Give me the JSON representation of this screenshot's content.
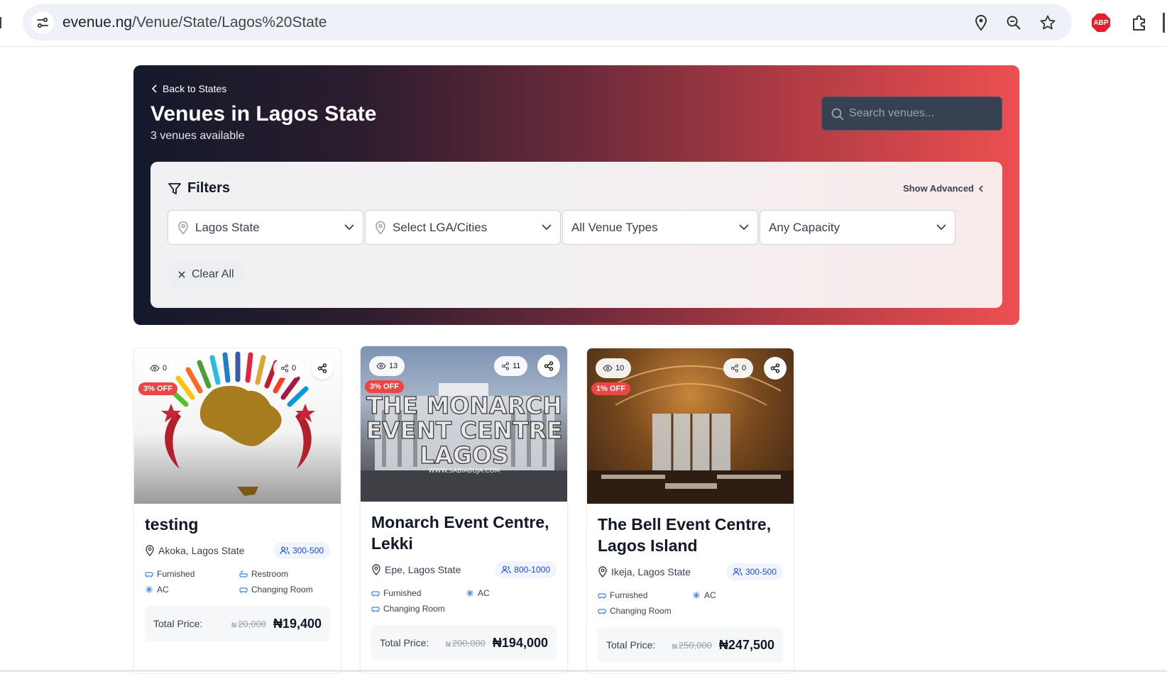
{
  "browser": {
    "url_host": "evenue.ng",
    "url_path": "/Venue/State/Lagos%20State",
    "icons": [
      "site-info-icon",
      "location-icon",
      "zoom-icon",
      "bookmark-star-icon",
      "adblock-icon",
      "extensions-icon"
    ],
    "adblock_label": "ABP"
  },
  "hero": {
    "back_label": "Back to States",
    "title": "Venues in Lagos State",
    "count_text": "3 venues available",
    "search_placeholder": "Search venues...",
    "gradient": [
      "#141a2b",
      "#ec4f50"
    ]
  },
  "filters": {
    "title": "Filters",
    "show_advanced": "Show Advanced",
    "state": "Lagos State",
    "lga": "Select LGA/Cities",
    "venue_type": "All Venue Types",
    "capacity": "Any Capacity",
    "clear_all": "Clear All"
  },
  "currency_symbol": "₦",
  "price_label": "Total Price:",
  "venues": [
    {
      "views": "0",
      "shares": "0",
      "discount": "3% OFF",
      "title": "testing",
      "location": "Akoka, Lagos State",
      "capacity": "300-500",
      "amenities": [
        "Furnished",
        "Restroom",
        "AC",
        "Changing Room"
      ],
      "old_price": "20,000",
      "price": "₦19,400"
    },
    {
      "views": "13",
      "shares": "11",
      "discount": "3% OFF",
      "title": "Monarch Event Centre, Lekki",
      "location": "Epe, Lagos State",
      "capacity": "800-1000",
      "amenities": [
        "Furnished",
        "AC",
        "Changing Room"
      ],
      "old_price": "200,000",
      "price": "₦194,000",
      "image_text": [
        "THE MONARCH",
        "EVENT CENTRE",
        "LAGOS",
        "WWW.SABIABUJA.COM"
      ]
    },
    {
      "views": "10",
      "shares": "0",
      "discount": "1% OFF",
      "title": "The Bell Event Centre, Lagos Island",
      "location": "Ikeja, Lagos State",
      "capacity": "300-500",
      "amenities": [
        "Furnished",
        "AC",
        "Changing Room"
      ],
      "old_price": "250,000",
      "price": "₦247,500"
    }
  ],
  "colors": {
    "discount": "#ef4444",
    "capacity_text": "#1d4ed8",
    "amenity_icon": "#3b82f6"
  }
}
